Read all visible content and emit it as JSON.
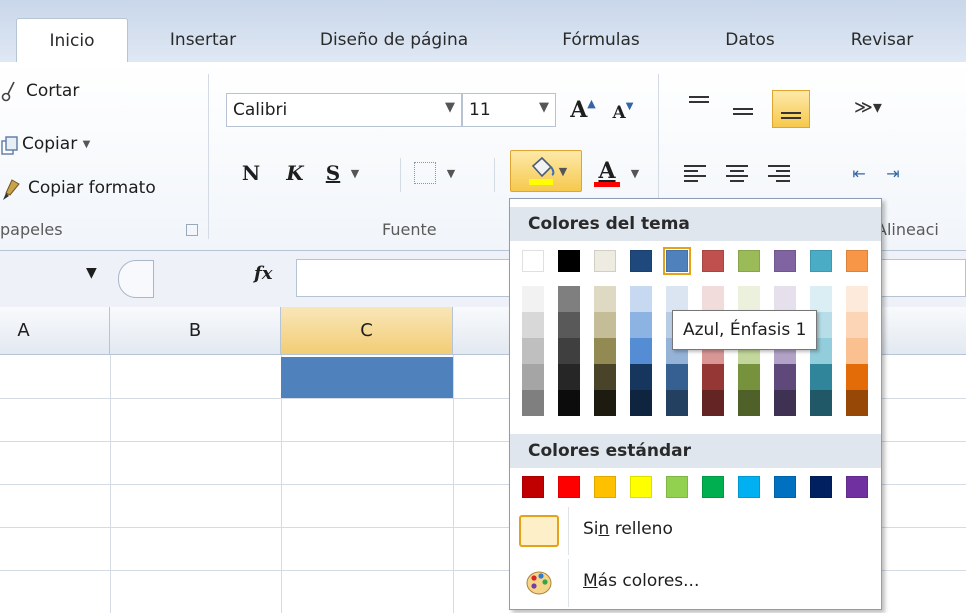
{
  "tabs": [
    "Inicio",
    "Insertar",
    "Diseño de página",
    "Fórmulas",
    "Datos",
    "Revisar"
  ],
  "clipboard": {
    "cut": "Cortar",
    "copy": "Copiar",
    "copy_arrow": "▼",
    "format_painter": "Copiar formato",
    "group_label": "papeles"
  },
  "font": {
    "name": "Calibri",
    "size": "11",
    "bold": "N",
    "italic": "K",
    "underline": "S",
    "group_label": "Fuente"
  },
  "alignment": {
    "group_label": "Alineaci"
  },
  "formula_bar": {
    "fx": "fx"
  },
  "columns": [
    "A",
    "B",
    "C"
  ],
  "fill_menu": {
    "theme_header": "Colores del tema",
    "standard_header": "Colores estándar",
    "no_fill_pre": "Si",
    "no_fill_u": "n",
    "no_fill_post": " relleno",
    "more_u": "M",
    "more_post": "ás colores...",
    "tooltip": "Azul, Énfasis 1",
    "selected_index": 4,
    "theme_colors": [
      "#FFFFFF",
      "#000000",
      "#EEECE1",
      "#1F497D",
      "#4F81BD",
      "#C0504D",
      "#9BBB59",
      "#8064A2",
      "#4BACC6",
      "#F79646"
    ],
    "theme_shades": [
      [
        "#F2F2F2",
        "#D8D8D8",
        "#BFBFBF",
        "#A5A5A5",
        "#7F7F7F"
      ],
      [
        "#7F7F7F",
        "#595959",
        "#3F3F3F",
        "#262626",
        "#0C0C0C"
      ],
      [
        "#DDD9C3",
        "#C4BD97",
        "#938953",
        "#494429",
        "#1D1B10"
      ],
      [
        "#C6D9F0",
        "#8DB3E2",
        "#548DD4",
        "#17365D",
        "#0F243E"
      ],
      [
        "#DBE5F1",
        "#B8CCE4",
        "#95B3D7",
        "#366092",
        "#244061"
      ],
      [
        "#F2DCDB",
        "#E5B9B7",
        "#D99694",
        "#953734",
        "#632423"
      ],
      [
        "#EBF1DD",
        "#D7E3BC",
        "#C3D69B",
        "#76923C",
        "#4F6128"
      ],
      [
        "#E5E0EC",
        "#CCC1D9",
        "#B2A2C7",
        "#5F497A",
        "#3F3151"
      ],
      [
        "#DBEEF3",
        "#B7DDE8",
        "#92CDDC",
        "#31859B",
        "#205867"
      ],
      [
        "#FDEADA",
        "#FBD5B5",
        "#FAC08F",
        "#E36C09",
        "#974806"
      ]
    ],
    "standard_colors": [
      "#C00000",
      "#FF0000",
      "#FFC000",
      "#FFFF00",
      "#92D050",
      "#00B050",
      "#00B0F0",
      "#0070C0",
      "#002060",
      "#7030A0"
    ]
  }
}
